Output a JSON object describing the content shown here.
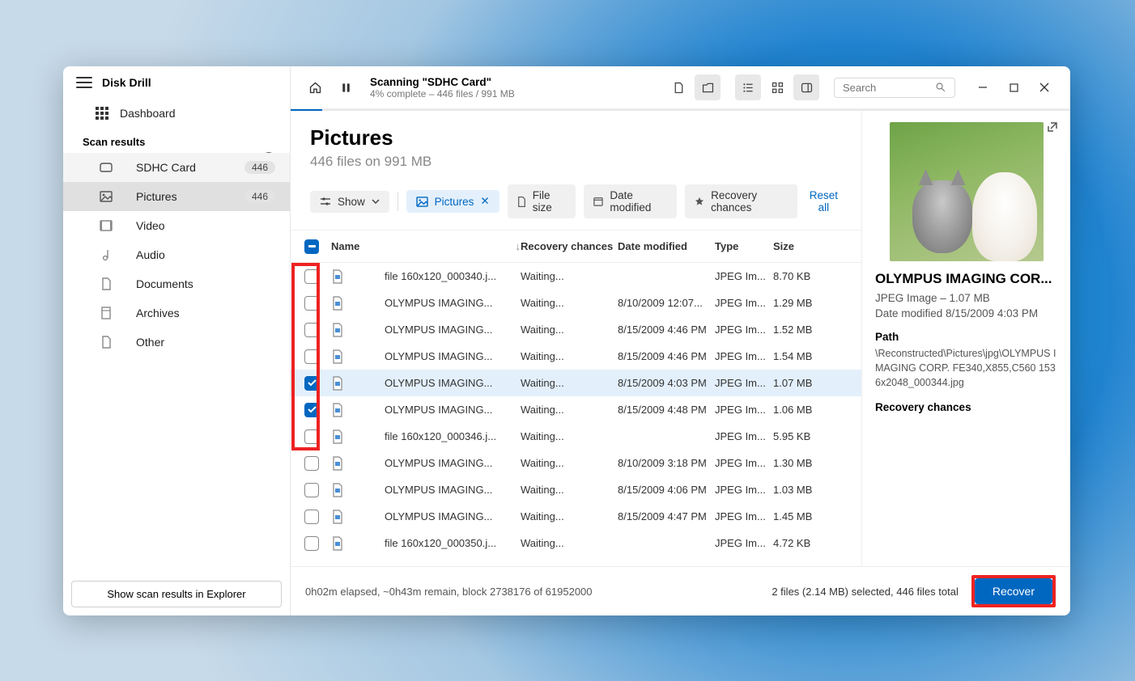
{
  "app_title": "Disk Drill",
  "sidebar": {
    "dashboard": "Dashboard",
    "scan_results_header": "Scan results",
    "items": [
      {
        "icon": "drive",
        "label": "SDHC Card",
        "badge": "446"
      },
      {
        "icon": "image",
        "label": "Pictures",
        "badge": "446"
      },
      {
        "icon": "video",
        "label": "Video",
        "badge": ""
      },
      {
        "icon": "audio",
        "label": "Audio",
        "badge": ""
      },
      {
        "icon": "doc",
        "label": "Documents",
        "badge": ""
      },
      {
        "icon": "archive",
        "label": "Archives",
        "badge": ""
      },
      {
        "icon": "other",
        "label": "Other",
        "badge": ""
      }
    ],
    "explorer_button": "Show scan results in Explorer"
  },
  "topbar": {
    "scan_title": "Scanning \"SDHC Card\"",
    "scan_sub": "4% complete – 446 files / 991 MB",
    "search_placeholder": "Search"
  },
  "header": {
    "title": "Pictures",
    "subtitle": "446 files on 991 MB"
  },
  "filters": {
    "show": "Show",
    "pictures": "Pictures",
    "filesize": "File size",
    "date": "Date modified",
    "recovery": "Recovery chances",
    "reset": "Reset all"
  },
  "columns": {
    "name": "Name",
    "recovery": "Recovery chances",
    "date": "Date modified",
    "type": "Type",
    "size": "Size"
  },
  "rows": [
    {
      "checked": false,
      "name": "file 160x120_000340.j...",
      "recovery": "Waiting...",
      "date": "",
      "type": "JPEG Im...",
      "size": "8.70 KB"
    },
    {
      "checked": false,
      "name": "OLYMPUS IMAGING...",
      "recovery": "Waiting...",
      "date": "8/10/2009 12:07...",
      "type": "JPEG Im...",
      "size": "1.29 MB"
    },
    {
      "checked": false,
      "name": "OLYMPUS IMAGING...",
      "recovery": "Waiting...",
      "date": "8/15/2009 4:46 PM",
      "type": "JPEG Im...",
      "size": "1.52 MB"
    },
    {
      "checked": false,
      "name": "OLYMPUS IMAGING...",
      "recovery": "Waiting...",
      "date": "8/15/2009 4:46 PM",
      "type": "JPEG Im...",
      "size": "1.54 MB"
    },
    {
      "checked": true,
      "sel": true,
      "name": "OLYMPUS IMAGING...",
      "recovery": "Waiting...",
      "date": "8/15/2009 4:03 PM",
      "type": "JPEG Im...",
      "size": "1.07 MB"
    },
    {
      "checked": true,
      "name": "OLYMPUS IMAGING...",
      "recovery": "Waiting...",
      "date": "8/15/2009 4:48 PM",
      "type": "JPEG Im...",
      "size": "1.06 MB"
    },
    {
      "checked": false,
      "name": "file 160x120_000346.j...",
      "recovery": "Waiting...",
      "date": "",
      "type": "JPEG Im...",
      "size": "5.95 KB"
    },
    {
      "checked": false,
      "name": "OLYMPUS IMAGING...",
      "recovery": "Waiting...",
      "date": "8/10/2009 3:18 PM",
      "type": "JPEG Im...",
      "size": "1.30 MB"
    },
    {
      "checked": false,
      "name": "OLYMPUS IMAGING...",
      "recovery": "Waiting...",
      "date": "8/15/2009 4:06 PM",
      "type": "JPEG Im...",
      "size": "1.03 MB"
    },
    {
      "checked": false,
      "name": "OLYMPUS IMAGING...",
      "recovery": "Waiting...",
      "date": "8/15/2009 4:47 PM",
      "type": "JPEG Im...",
      "size": "1.45 MB"
    },
    {
      "checked": false,
      "name": "file 160x120_000350.j...",
      "recovery": "Waiting...",
      "date": "",
      "type": "JPEG Im...",
      "size": "4.72 KB"
    }
  ],
  "preview": {
    "title": "OLYMPUS IMAGING COR...",
    "meta": "JPEG Image – 1.07 MB",
    "date": "Date modified 8/15/2009 4:03 PM",
    "path_label": "Path",
    "path": "\\Reconstructed\\Pictures\\jpg\\OLYMPUS IMAGING CORP. FE340,X855,C560 1536x2048_000344.jpg",
    "recovery_label": "Recovery chances"
  },
  "footer": {
    "status": "0h02m elapsed, ~0h43m remain, block 2738176 of 61952000",
    "selection": "2 files (2.14 MB) selected, 446 files total",
    "recover": "Recover"
  }
}
